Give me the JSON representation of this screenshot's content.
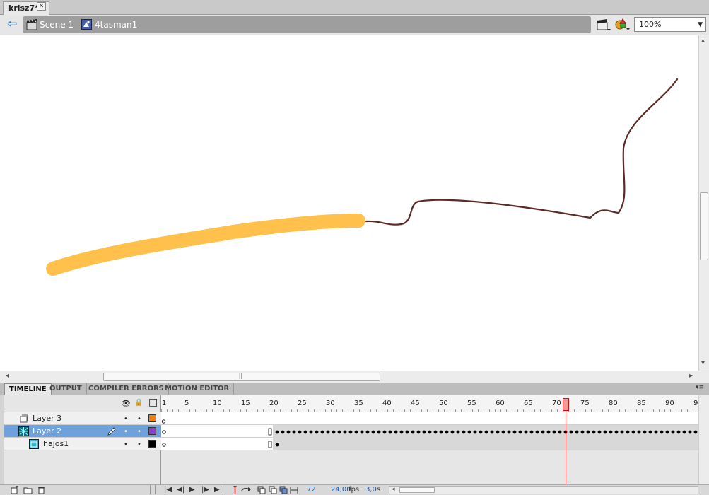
{
  "document_tab": {
    "title": "krisz7*",
    "close_glyph": "✕"
  },
  "edit_bar": {
    "back_glyph": "⇦",
    "scene_label": "Scene 1",
    "symbol_label": "4tasman1",
    "zoom_value": "100%",
    "zoom_arrow": "▼"
  },
  "scroll": {
    "left_arrow": "◂",
    "right_arrow": "▸",
    "up_arrow": "▴",
    "down_arrow": "▾",
    "grip": "|||"
  },
  "panel_tabs": [
    "TIMELINE",
    "OUTPUT",
    "COMPILER ERRORS",
    "MOTION EDITOR"
  ],
  "panel_menu_glyph": "▾≡",
  "timeline": {
    "header_glyphs": {
      "eye": "👁",
      "lock": "🔒",
      "outline": "□"
    },
    "layers": [
      {
        "name": "Layer 3",
        "color": "#f07f10",
        "selected": false,
        "indent": false
      },
      {
        "name": "Layer 2",
        "color": "#8a3fd1",
        "selected": true,
        "indent": false
      },
      {
        "name": "hajos1",
        "color": "#000000",
        "selected": false,
        "indent": true
      }
    ],
    "layer_dot": "•",
    "ruler_labels": [
      "1",
      "5",
      "10",
      "15",
      "20",
      "25",
      "30",
      "35",
      "40",
      "45",
      "50",
      "55",
      "60",
      "65",
      "70",
      "75",
      "80",
      "85",
      "90",
      "9"
    ],
    "current_frame": 72,
    "controls": {
      "frame_value": "72",
      "fps_value": "24,00",
      "fps_unit": "fps",
      "time_value": "3,0",
      "time_unit": "s",
      "playback_glyphs": [
        "|◀",
        "◀|",
        "▶",
        "|▶",
        "▶|"
      ]
    }
  },
  "colors": {
    "stroke_thick": "#ffc04c",
    "stroke_thin": "#5c2a26",
    "playhead": "#cc1111",
    "selection": "#6fa2dc"
  }
}
